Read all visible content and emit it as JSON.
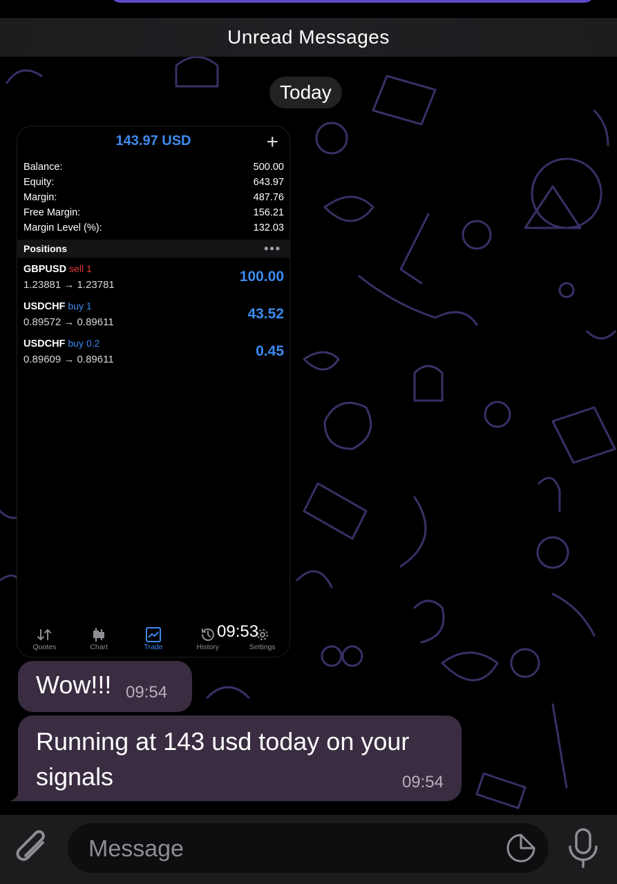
{
  "banner": {
    "unread_label": "Unread Messages"
  },
  "date_separator": "Today",
  "screenshot_message": {
    "time": "09:53",
    "app": {
      "header_title": "143.97 USD",
      "account": [
        {
          "label": "Balance:",
          "value": "500.00"
        },
        {
          "label": "Equity:",
          "value": "643.97"
        },
        {
          "label": "Margin:",
          "value": "487.76"
        },
        {
          "label": "Free Margin:",
          "value": "156.21"
        },
        {
          "label": "Margin Level (%):",
          "value": "132.03"
        }
      ],
      "positions_title": "Positions",
      "positions": [
        {
          "symbol": "GBPUSD",
          "side": "sell 1",
          "prices": "1.23881 → 1.23781",
          "profit": "100.00"
        },
        {
          "symbol": "USDCHF",
          "side": "buy 1",
          "prices": "0.89572 → 0.89611",
          "profit": "43.52"
        },
        {
          "symbol": "USDCHF",
          "side": "buy 0.2",
          "prices": "0.89609 → 0.89611",
          "profit": "0.45"
        }
      ],
      "tabs": [
        {
          "label": "Quotes",
          "icon": "quotes-arrows-icon"
        },
        {
          "label": "Chart",
          "icon": "candlestick-icon"
        },
        {
          "label": "Trade",
          "icon": "trade-chart-icon",
          "active": true
        },
        {
          "label": "History",
          "icon": "history-clock-icon"
        },
        {
          "label": "Settings",
          "icon": "settings-gear-icon"
        }
      ],
      "accent_color": "#3d8bf0",
      "sell_color": "#e23b3b"
    }
  },
  "messages": [
    {
      "text": "Wow!!!",
      "time": "09:54"
    },
    {
      "text": "Running at  143 usd today on your signals",
      "time": "09:54"
    }
  ],
  "composer": {
    "placeholder": "Message",
    "attach_icon": "paperclip-icon",
    "sticker_icon": "sticker-icon",
    "mic_icon": "microphone-icon"
  },
  "colors": {
    "bubble": "#3a2d42",
    "composer_bar": "#1c1c1e",
    "doodle": "#3b2f66"
  }
}
